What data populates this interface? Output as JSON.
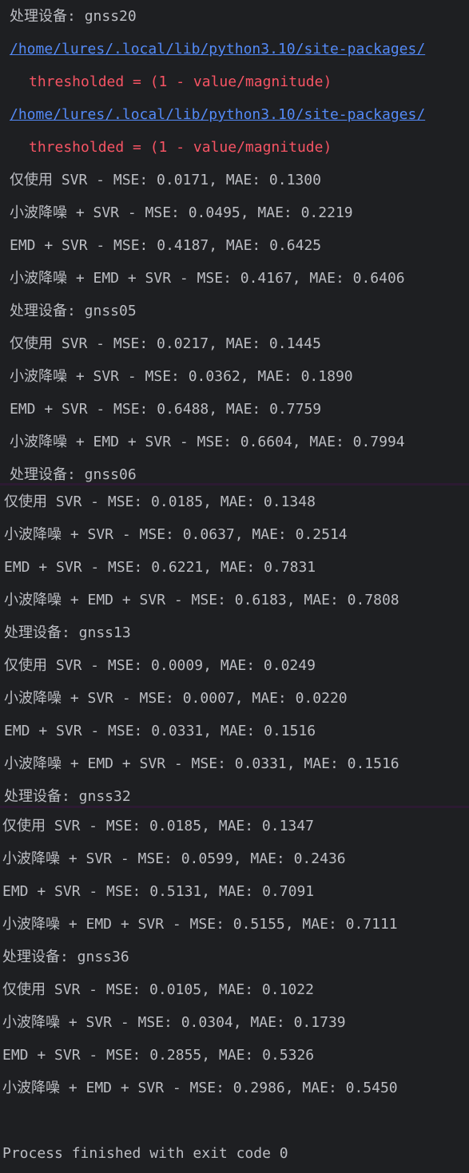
{
  "console": {
    "device_prefix": "处理设备: ",
    "header_device": "gnss20",
    "warnings": [
      {
        "path": "/home/lures/.local/lib/python3.10/site-packages/",
        "code": "thresholded = (1 - value/magnitude)"
      },
      {
        "path": "/home/lures/.local/lib/python3.10/site-packages/",
        "code": "thresholded = (1 - value/magnitude)"
      }
    ],
    "blocks": [
      {
        "device": "gnss20",
        "results": [
          "仅使用 SVR - MSE: 0.0171, MAE: 0.1300",
          "小波降噪 + SVR - MSE: 0.0495, MAE: 0.2219",
          "EMD + SVR - MSE: 0.4187, MAE: 0.6425",
          "小波降噪 + EMD + SVR - MSE: 0.4167, MAE: 0.6406"
        ]
      },
      {
        "device": "gnss05",
        "header": "处理设备: gnss05",
        "results": [
          "仅使用 SVR - MSE: 0.0217, MAE: 0.1445",
          "小波降噪 + SVR - MSE: 0.0362, MAE: 0.1890",
          "EMD + SVR - MSE: 0.6488, MAE: 0.7759",
          "小波降噪 + EMD + SVR - MSE: 0.6604, MAE: 0.7994"
        ]
      },
      {
        "device": "gnss06",
        "header": "处理设备: gnss06",
        "results": [
          "仅使用 SVR - MSE: 0.0185, MAE: 0.1348",
          "小波降噪 + SVR - MSE: 0.0637, MAE: 0.2514",
          "EMD + SVR - MSE: 0.6221, MAE: 0.7831",
          "小波降噪 + EMD + SVR - MSE: 0.6183, MAE: 0.7808"
        ]
      },
      {
        "device": "gnss13",
        "header": "处理设备: gnss13",
        "results": [
          "仅使用 SVR - MSE: 0.0009, MAE: 0.0249",
          "小波降噪 + SVR - MSE: 0.0007, MAE: 0.0220",
          "EMD + SVR - MSE: 0.0331, MAE: 0.1516",
          "小波降噪 + EMD + SVR - MSE: 0.0331, MAE: 0.1516"
        ]
      },
      {
        "device": "gnss32",
        "header": "处理设备: gnss32",
        "results": [
          "仅使用 SVR - MSE: 0.0185, MAE: 0.1347",
          "小波降噪 + SVR - MSE: 0.0599, MAE: 0.2436",
          "EMD + SVR - MSE: 0.5131, MAE: 0.7091",
          "小波降噪 + EMD + SVR - MSE: 0.5155, MAE: 0.7111"
        ]
      },
      {
        "device": "gnss36",
        "header": "处理设备: gnss36",
        "results": [
          "仅使用 SVR - MSE: 0.0105, MAE: 0.1022",
          "小波降噪 + SVR - MSE: 0.0304, MAE: 0.1739",
          "EMD + SVR - MSE: 0.2855, MAE: 0.5326",
          "小波降噪 + EMD + SVR - MSE: 0.2986, MAE: 0.5450"
        ]
      }
    ],
    "exit_message": "Process finished with exit code 0"
  },
  "colors": {
    "background": "#1e1f22",
    "text": "#bcbec4",
    "link": "#548af7",
    "error": "#f75464",
    "separator": "#2c1a32"
  }
}
